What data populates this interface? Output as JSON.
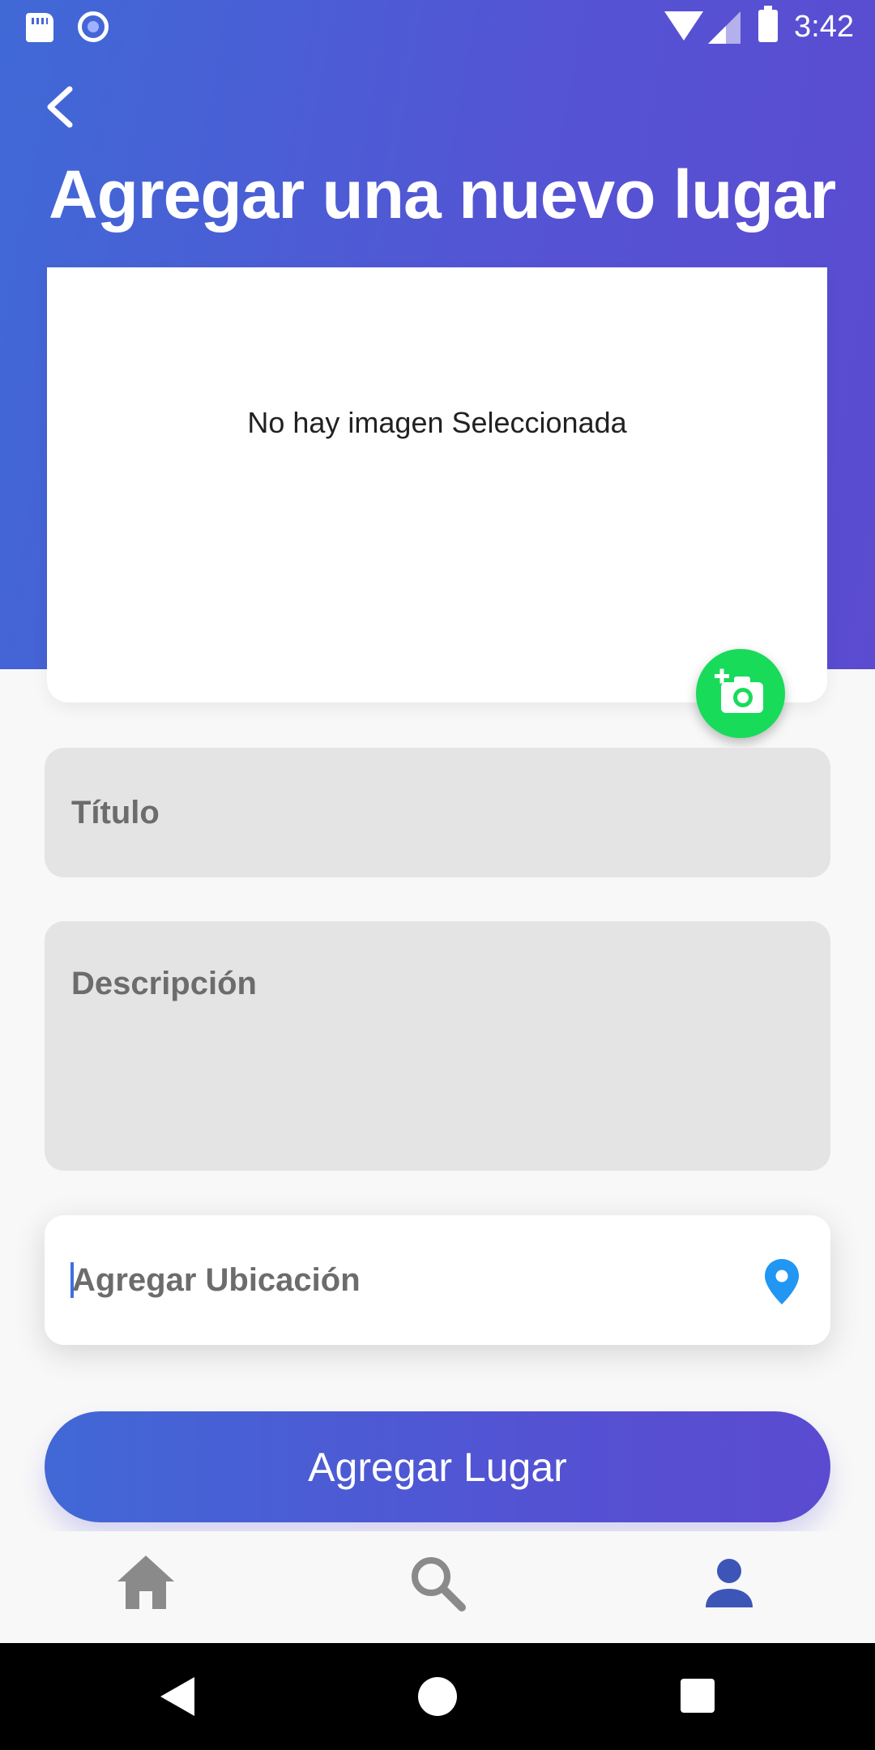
{
  "status_bar": {
    "time": "3:42",
    "icons": [
      "sd-card-icon",
      "notification-circle-icon",
      "wifi-icon",
      "signal-icon",
      "battery-icon"
    ]
  },
  "header": {
    "back_icon": "chevron-left-icon",
    "title": "Agregar una nuevo lugar"
  },
  "image_card": {
    "placeholder_text": "No hay imagen Seleccionada",
    "camera_button_icon": "add-photo-camera-icon",
    "camera_button_color": "#18db5a"
  },
  "form": {
    "title_placeholder": "Título",
    "description_placeholder": "Descripción",
    "location_placeholder": "Agregar Ubicación",
    "location_icon": "map-pin-icon",
    "location_icon_color": "#2196f3"
  },
  "submit": {
    "label": "Agregar Lugar"
  },
  "bottom_nav": {
    "items": [
      {
        "icon": "home-icon",
        "active": false
      },
      {
        "icon": "search-icon",
        "active": false
      },
      {
        "icon": "profile-icon",
        "active": true
      }
    ],
    "active_color": "#3e55b8",
    "inactive_color": "#8a8a8a"
  },
  "colors": {
    "gradient_start": "#4069d6",
    "gradient_end": "#5b4bd0",
    "field_background": "#e4e4e4"
  }
}
